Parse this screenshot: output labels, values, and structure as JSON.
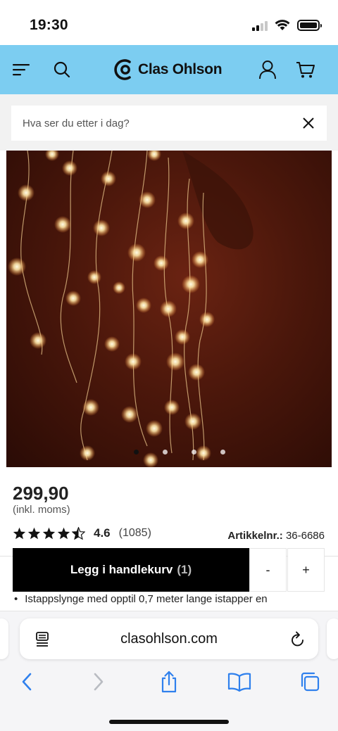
{
  "status_bar": {
    "time": "19:30"
  },
  "header": {
    "brand": "Clas Ohlson",
    "accent_color": "#7ccdf1",
    "icons": [
      "menu-icon",
      "search-icon",
      "account-icon",
      "cart-icon"
    ]
  },
  "search": {
    "placeholder": "Hva ser du etter i dag?"
  },
  "product": {
    "image_alt_icon": "icicle-light-chain-photo",
    "carousel": {
      "slides": 4,
      "active_index": 0
    },
    "price": "299,90",
    "vat_note": "(inkl. moms)",
    "rating": {
      "stars": 4.6,
      "value": "4.6",
      "count": "(1085)"
    },
    "article_label": "Artikkelnr.:",
    "article_number": "36-6686",
    "add_to_cart": {
      "label": "Legg i handlekurv",
      "count": "(1)"
    },
    "qty_minus": "-",
    "qty_plus": "+",
    "bullet_text": "Istappslynge med opptil 0,7 meter lange istapper en"
  },
  "browser": {
    "url": "clasohlson.com",
    "icons": [
      "reader-icon",
      "reload-icon",
      "back-icon",
      "forward-icon",
      "share-icon",
      "bookmarks-icon",
      "tabs-icon"
    ]
  }
}
